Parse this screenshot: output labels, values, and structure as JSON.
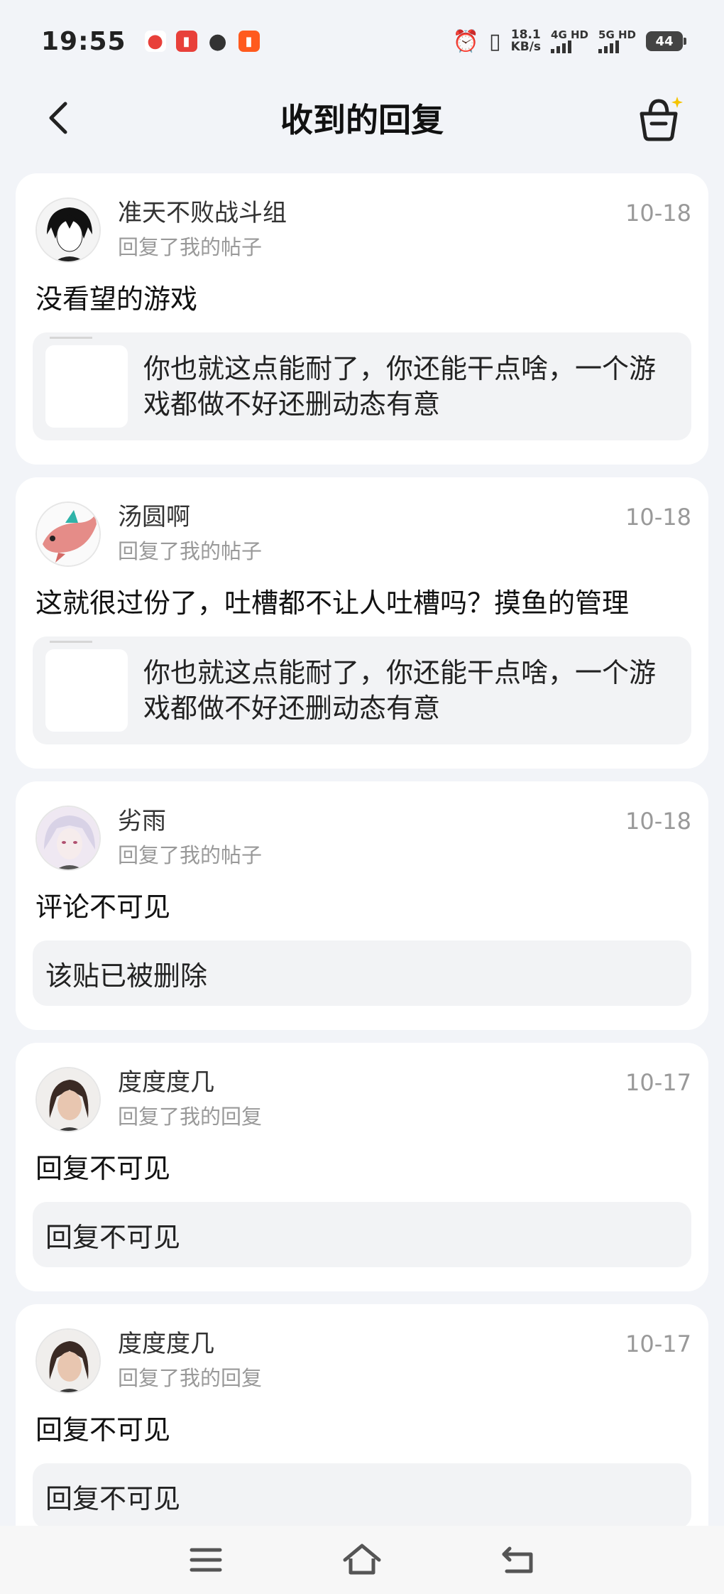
{
  "status": {
    "time": "19:55",
    "speed_value": "18.1",
    "speed_unit": "KB/s",
    "net1": "4G HD",
    "net2": "5G HD",
    "battery": "44"
  },
  "header": {
    "title": "收到的回复"
  },
  "replies": [
    {
      "user": "准天不败战斗组",
      "type": "回复了我的帖子",
      "date": "10-18",
      "comment": "没看望的游戏",
      "quote": "你也就这点能耐了，你还能干点啥，一个游戏都做不好还删动态有意"
    },
    {
      "user": "汤圆啊",
      "type": "回复了我的帖子",
      "date": "10-18",
      "comment": "这就很过份了，吐槽都不让人吐槽吗？摸鱼的管理",
      "quote": "你也就这点能耐了，你还能干点啥，一个游戏都做不好还删动态有意"
    },
    {
      "user": "劣雨",
      "type": "回复了我的帖子",
      "date": "10-18",
      "comment": "评论不可见",
      "quote": "该贴已被删除"
    },
    {
      "user": "度度度几",
      "type": "回复了我的回复",
      "date": "10-17",
      "comment": "回复不可见",
      "quote": "回复不可见"
    },
    {
      "user": "度度度几",
      "type": "回复了我的回复",
      "date": "10-17",
      "comment": "回复不可见",
      "quote": "回复不可见"
    }
  ],
  "icons": {
    "back": "chevron-left-icon",
    "basket": "basket-sparkle-icon",
    "nav_menu": "menu-icon",
    "nav_home": "home-icon",
    "nav_back": "back-icon"
  },
  "colors": {
    "background": "#f2f4f8",
    "card": "#ffffff",
    "quote_bg": "#f2f3f5",
    "muted_text": "#999999",
    "sparkle": "#f5c400"
  }
}
